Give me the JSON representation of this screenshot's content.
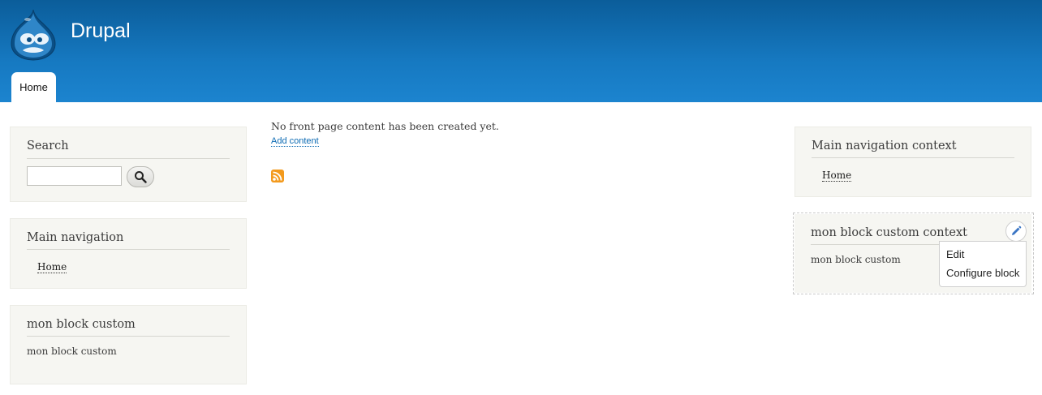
{
  "header": {
    "site_name": "Drupal",
    "tabs": [
      {
        "label": "Home"
      }
    ]
  },
  "sidebar_first": {
    "search": {
      "title": "Search",
      "input_value": "",
      "button_icon": "search-icon"
    },
    "main_navigation": {
      "title": "Main navigation",
      "items": [
        {
          "label": "Home"
        }
      ]
    },
    "custom_block": {
      "title": "mon block custom",
      "body": "mon block custom"
    }
  },
  "main": {
    "message": "No front page content has been created yet.",
    "add_content_link": "Add content",
    "feed_icon": "rss-icon"
  },
  "sidebar_second": {
    "main_navigation_context": {
      "title": "Main navigation context",
      "items": [
        {
          "label": "Home"
        }
      ]
    },
    "custom_block_context": {
      "title": "mon block custom context",
      "body": "mon block custom",
      "contextual_trigger_icon": "pencil-icon",
      "contextual_links": [
        {
          "label": "Edit"
        },
        {
          "label": "Configure block"
        }
      ]
    }
  },
  "colors": {
    "header_top": "#0b5d9a",
    "header_bottom": "#1c84cf",
    "block_bg": "#f6f6f2",
    "link": "#0b6ab3",
    "feed": "#f39a1d"
  }
}
